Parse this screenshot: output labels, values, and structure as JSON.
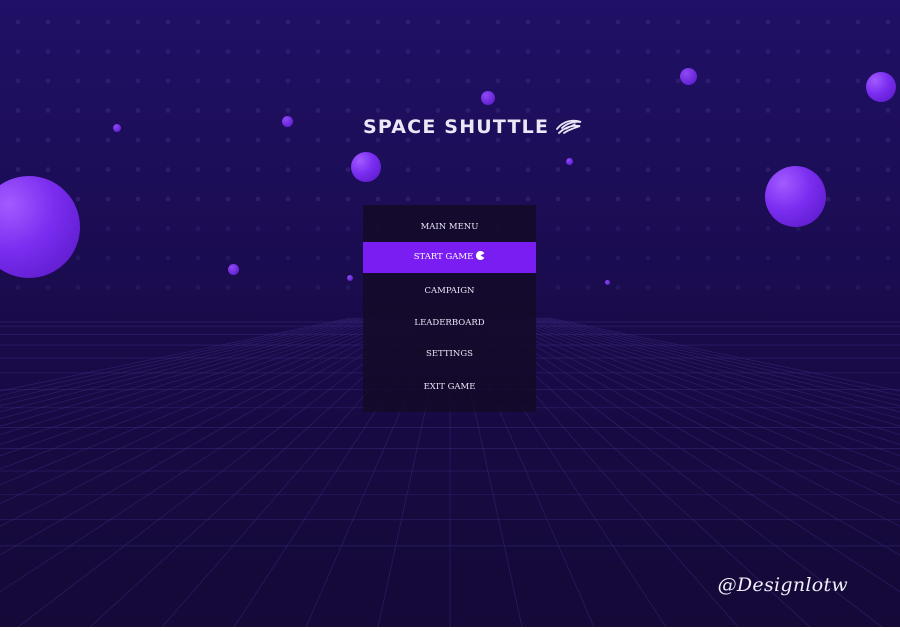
{
  "game": {
    "title": "SPACE SHUTTLE",
    "logo_icon": "eye-swoosh-icon"
  },
  "menu": {
    "header": "MAIN MENU",
    "items": [
      {
        "label": "START GAME",
        "selected": true,
        "icon": "pacman-icon"
      },
      {
        "label": "CAMPAIGN",
        "selected": false
      },
      {
        "label": "LEADERBOARD",
        "selected": false
      },
      {
        "label": "SETTINGS",
        "selected": false
      },
      {
        "label": "EXIT GAME",
        "selected": false
      }
    ]
  },
  "watermark": "@Designlotw",
  "colors": {
    "background_top": "#201066",
    "background_bottom": "#140937",
    "accent": "#7a1df2",
    "sphere": "#7a2df0",
    "text": "#ece7f7"
  }
}
